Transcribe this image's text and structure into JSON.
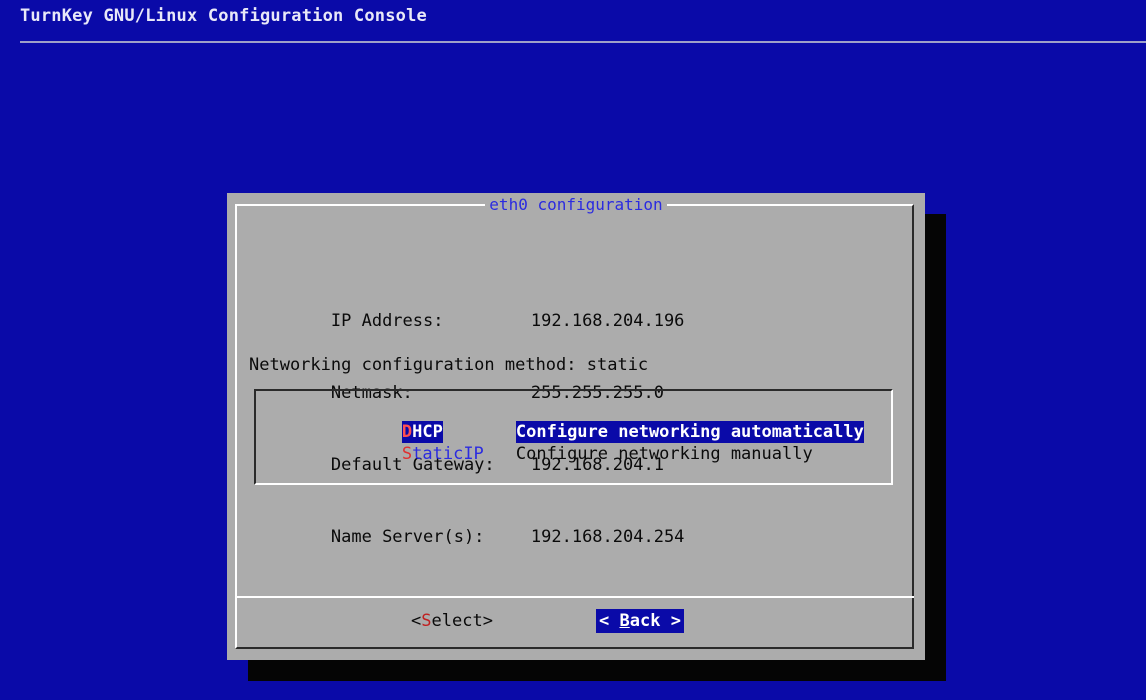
{
  "console": {
    "title": "TurnKey GNU/Linux Configuration Console"
  },
  "dialog": {
    "title": "eth0 configuration",
    "info": [
      {
        "label": "IP Address:",
        "value": "192.168.204.196"
      },
      {
        "label": "Netmask:",
        "value": "255.255.255.0"
      },
      {
        "label": "Default Gateway:",
        "value": "192.168.204.1"
      },
      {
        "label": "Name Server(s):",
        "value": "192.168.204.254"
      }
    ],
    "method_text": "Networking configuration method: static",
    "menu": [
      {
        "tag_hotkey": "D",
        "tag_rest": "HCP",
        "description": "Configure networking automatically",
        "selected": true
      },
      {
        "tag_hotkey": "S",
        "tag_rest": "taticIP",
        "description": "Configure networking manually",
        "selected": false
      }
    ],
    "buttons": {
      "select": {
        "left": "<",
        "hotkey": "S",
        "rest": "elect",
        "right": ">"
      },
      "back": {
        "left": "< ",
        "hotkey": "B",
        "rest": "ack",
        "right": " >"
      }
    }
  },
  "colors": {
    "background": "#0a0aa8",
    "dialog": "#acacac",
    "title_text": "#2b2be0",
    "hotkey": "#e03030",
    "selection": "#0a0aa8"
  }
}
